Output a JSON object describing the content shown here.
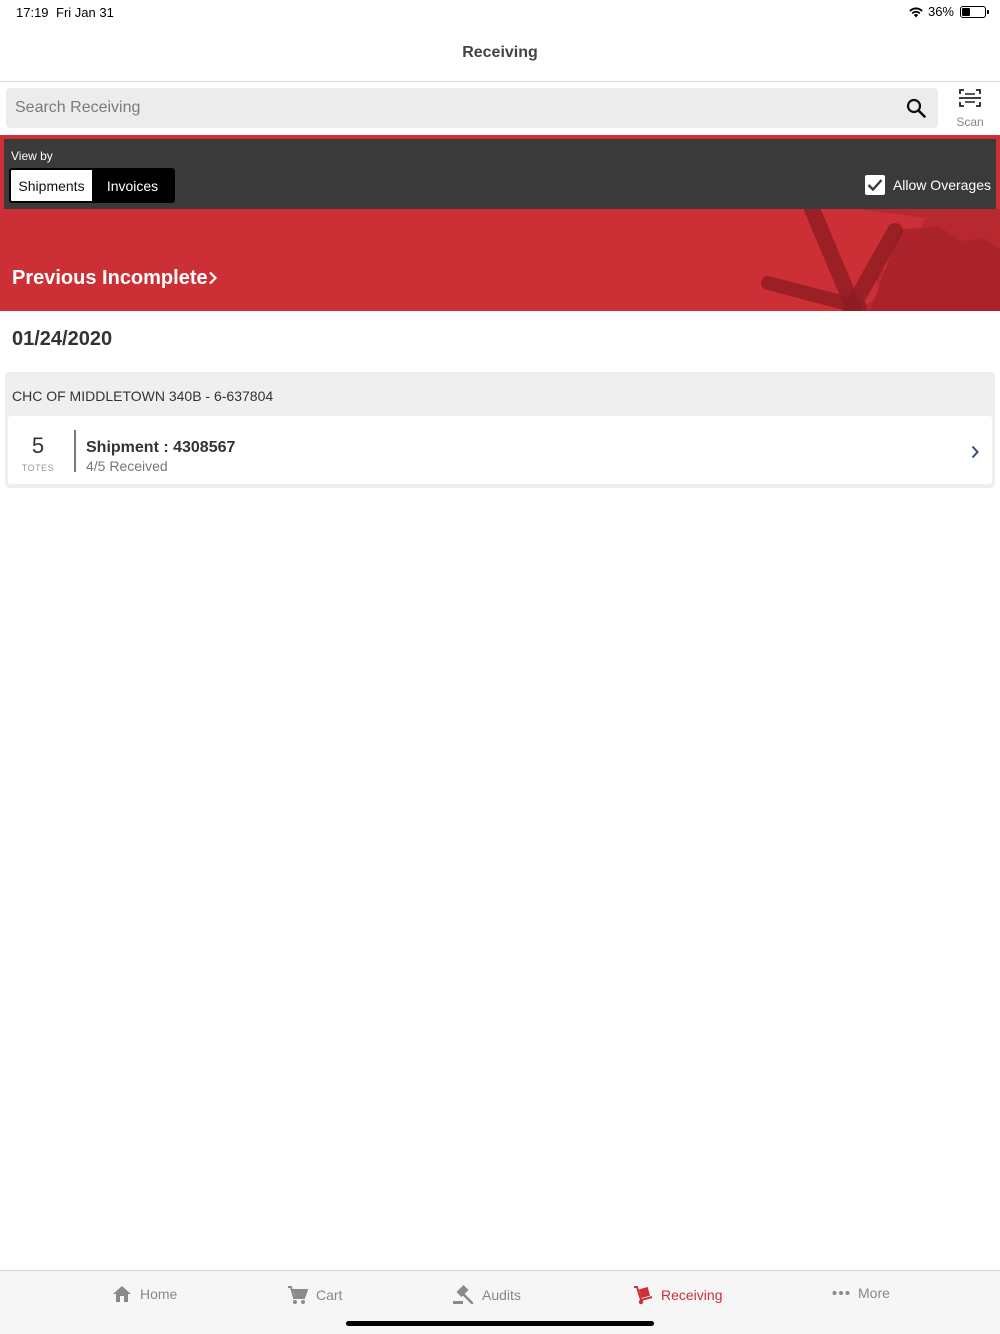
{
  "status_bar": {
    "time": "17:19",
    "date": "Fri Jan 31",
    "battery": "36%",
    "battery_level": 0.36
  },
  "nav": {
    "title": "Receiving"
  },
  "search": {
    "placeholder": "Search Receiving",
    "value": ""
  },
  "scan": {
    "label": "Scan"
  },
  "view_by": {
    "label": "View by",
    "options": [
      "Shipments",
      "Invoices"
    ],
    "selected": "Shipments"
  },
  "allow_overages": {
    "label": "Allow Overages",
    "checked": true
  },
  "banner": {
    "label": "Previous Incomplete"
  },
  "groups": [
    {
      "date": "01/24/2020",
      "title": "CHC OF MIDDLETOWN 340B - 6-637804",
      "shipments": [
        {
          "count": "5",
          "count_label": "TOTES",
          "title": "Shipment : 4308567",
          "status": "4/5 Received"
        }
      ]
    }
  ],
  "tabs": [
    {
      "label": "Home",
      "icon": "home-icon",
      "active": false
    },
    {
      "label": "Cart",
      "icon": "cart-icon",
      "active": false
    },
    {
      "label": "Audits",
      "icon": "gavel-icon",
      "active": false
    },
    {
      "label": "Receiving",
      "icon": "hand-truck-icon",
      "active": true
    },
    {
      "label": "More",
      "icon": "more-dots-icon",
      "active": false
    }
  ],
  "colors": {
    "brand_red": "#cc2f35",
    "panel_dark": "#3a3a3a",
    "tab_inactive": "#888888"
  }
}
